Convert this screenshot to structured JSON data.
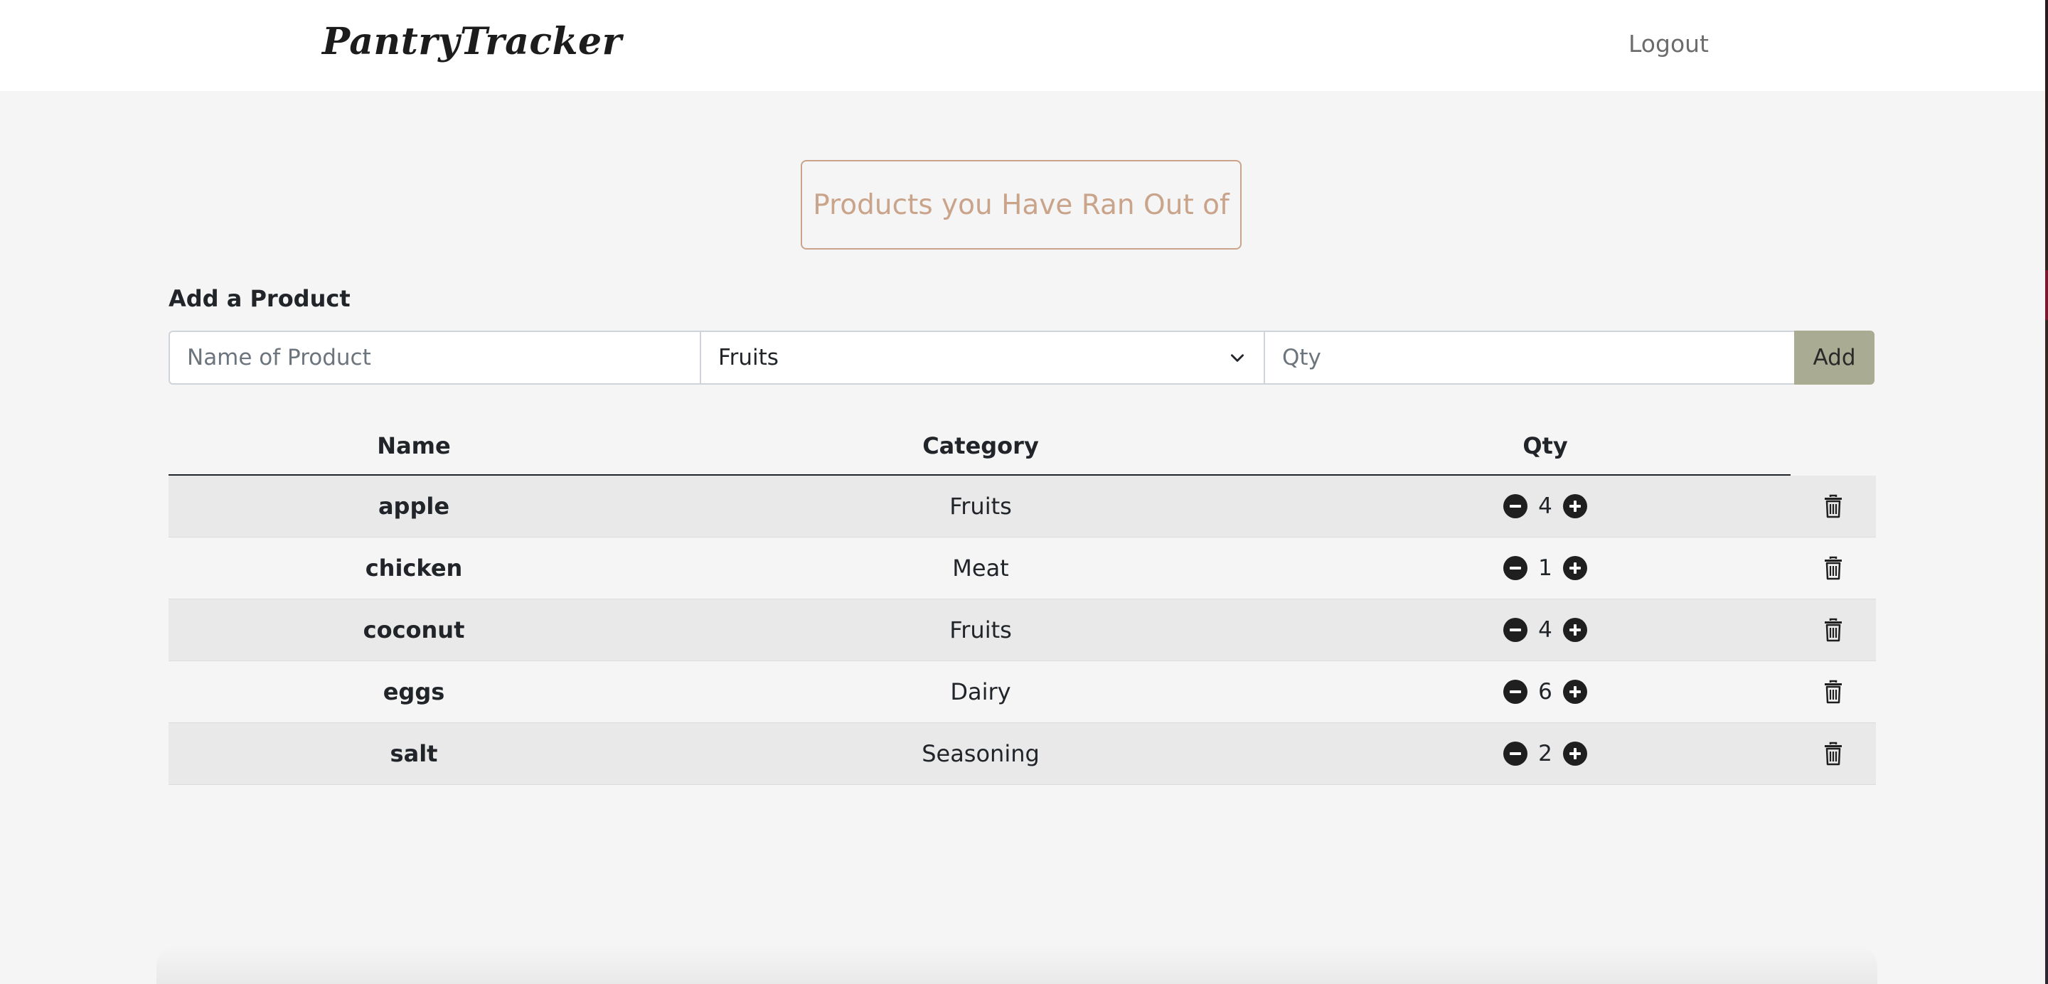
{
  "header": {
    "brand": "PantryTracker",
    "logout_label": "Logout"
  },
  "out_of_stock_button": "Products you Have Ran Out of",
  "add_form": {
    "title": "Add a Product",
    "name_placeholder": "Name of Product",
    "category_selected": "Fruits",
    "qty_placeholder": "Qty",
    "add_label": "Add"
  },
  "table": {
    "columns": [
      "Name",
      "Category",
      "Qty"
    ],
    "rows": [
      {
        "name": "apple",
        "category": "Fruits",
        "qty": "4"
      },
      {
        "name": "chicken",
        "category": "Meat",
        "qty": "1"
      },
      {
        "name": "coconut",
        "category": "Fruits",
        "qty": "4"
      },
      {
        "name": "eggs",
        "category": "Dairy",
        "qty": "6"
      },
      {
        "name": "salt",
        "category": "Seasoning",
        "qty": "2"
      }
    ]
  },
  "icons": {
    "decrement": "minus-circle-icon",
    "increment": "plus-circle-icon",
    "delete": "trash-icon",
    "dropdown": "chevron-down-icon"
  },
  "colors": {
    "accent": "#c9a38a",
    "add_button": "#aaab93",
    "row_stripe": "#e9e9e9",
    "page_background": "#f5f5f5"
  }
}
